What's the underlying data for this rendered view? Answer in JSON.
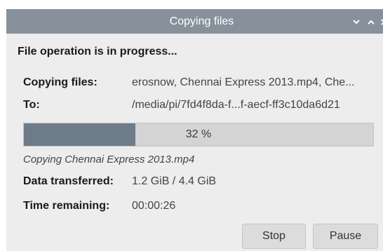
{
  "window": {
    "title": "Copying files"
  },
  "dialog": {
    "heading": "File operation is in progress...",
    "copying_label": "Copying files:",
    "copying_value": "erosnow, Chennai Express 2013.mp4, Che...",
    "to_label": "To:",
    "to_value": "/media/pi/7fd4f8da-f...f-aecf-ff3c10da6d21",
    "progress": {
      "percent": 32,
      "label": "32 %"
    },
    "current_file": "Copying Chennai Express 2013.mp4",
    "transferred_label": "Data transferred:",
    "transferred_value": "1.2 GiB / 4.4 GiB",
    "remaining_label": "Time remaining:",
    "remaining_value": "00:00:26"
  },
  "buttons": {
    "stop": "Stop",
    "pause": "Pause"
  },
  "icons": {
    "minimize": "chevron-down-icon",
    "maximize": "chevron-up-icon",
    "close": "close-icon"
  },
  "colors": {
    "titlebar": "#87919b",
    "progress_fill": "#6e7b88",
    "progress_track": "#d4d4d4",
    "window_bg": "#ededed"
  }
}
